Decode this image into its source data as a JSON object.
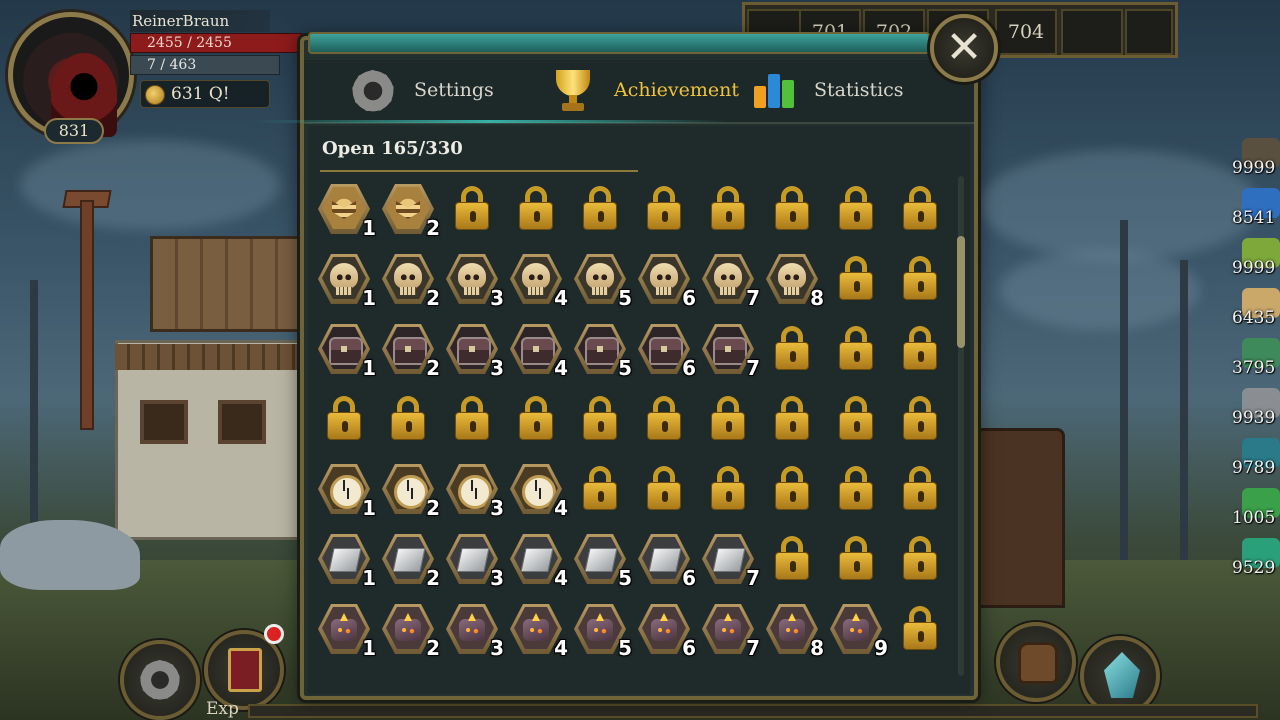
{
  "player": {
    "name": "ReinerBraun",
    "hp": "2455 / 2455",
    "mp": "7 / 463",
    "gold": "631 Q!",
    "level": "831"
  },
  "hotbar": [
    "",
    "701",
    "702",
    "",
    "704",
    "",
    ""
  ],
  "resources": [
    {
      "count": "9999",
      "color": "#5a5040"
    },
    {
      "count": "8541",
      "color": "#2f6fbf"
    },
    {
      "count": "9999",
      "color": "#7ea83a"
    },
    {
      "count": "6435",
      "color": "#c9a86a"
    },
    {
      "count": "3795",
      "color": "#3e8a5a"
    },
    {
      "count": "9939",
      "color": "#8a8e92"
    },
    {
      "count": "9789",
      "color": "#2a7a8a"
    },
    {
      "count": "1005",
      "color": "#3aa04a"
    },
    {
      "count": "9529",
      "color": "#2aa07a"
    }
  ],
  "hud": {
    "exp_label": "Exp"
  },
  "modal": {
    "tabs": [
      {
        "label": "Settings",
        "icon": "gear-icon",
        "active": false
      },
      {
        "label": "Achievement",
        "icon": "trophy-icon",
        "active": true
      },
      {
        "label": "Statistics",
        "icon": "bar-chart-icon",
        "active": false
      }
    ],
    "open_count": "Open 165/330",
    "close_icon": "close-icon",
    "grid": [
      {
        "icon": "ic-rank",
        "levels": [
          "1",
          "2",
          null,
          null,
          null,
          null,
          null,
          null,
          null,
          null
        ]
      },
      {
        "icon": "ic-skull",
        "levels": [
          "1",
          "2",
          "3",
          "4",
          "5",
          "6",
          "7",
          "8",
          null,
          null
        ]
      },
      {
        "icon": "ic-chest",
        "levels": [
          "1",
          "2",
          "3",
          "4",
          "5",
          "6",
          "7",
          null,
          null,
          null
        ]
      },
      {
        "icon": "ic-none",
        "levels": [
          null,
          null,
          null,
          null,
          null,
          null,
          null,
          null,
          null,
          null
        ]
      },
      {
        "icon": "ic-clock",
        "levels": [
          "1",
          "2",
          "3",
          "4",
          null,
          null,
          null,
          null,
          null,
          null
        ]
      },
      {
        "icon": "ic-ingot",
        "levels": [
          "1",
          "2",
          "3",
          "4",
          "5",
          "6",
          "7",
          null,
          null,
          null
        ]
      },
      {
        "icon": "ic-ore",
        "levels": [
          "1",
          "2",
          "3",
          "4",
          "5",
          "6",
          "7",
          "8",
          "9",
          null
        ]
      }
    ]
  }
}
